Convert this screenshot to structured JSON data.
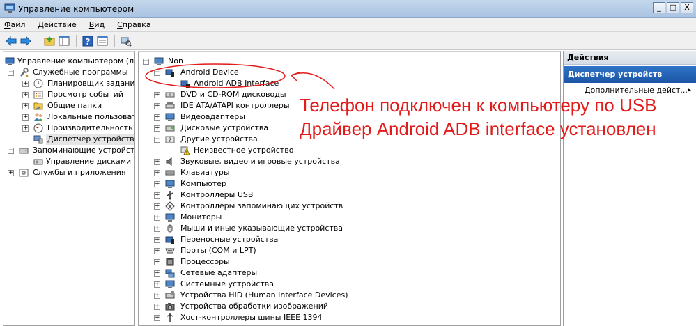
{
  "window": {
    "title": "Управление компьютером",
    "buttons": {
      "minimize": "_",
      "maximize": "□",
      "close": "X"
    }
  },
  "menu": {
    "items": [
      {
        "accel": "Ф",
        "rest": "айл"
      },
      {
        "accel": "Д",
        "rest": "ействие"
      },
      {
        "accel": "В",
        "rest": "ид"
      },
      {
        "accel": "С",
        "rest": "правка"
      }
    ]
  },
  "toolbar": {
    "icons": [
      "back-arrow-icon",
      "forward-arrow-icon",
      "up-folder-icon",
      "show-hide-tree-icon",
      "help-icon",
      "properties-icon",
      "scan-hardware-icon"
    ]
  },
  "left_tree": {
    "root": "Управление компьютером (лока",
    "system_tools": "Служебные программы",
    "task_scheduler": "Планировщик заданий",
    "event_viewer": "Просмотр событий",
    "shared_folders": "Общие папки",
    "local_users": "Локальные пользовател",
    "performance": "Производительность",
    "device_manager": "Диспетчер устройств",
    "storage": "Запоминающие устройства",
    "disk_management": "Управление дисками",
    "services": "Службы и приложения"
  },
  "device_tree": {
    "computer_name": "iNon",
    "android_device": "Android Device",
    "android_adb": "Android ADB Interface",
    "dvd": "DVD и CD-ROM дисководы",
    "ide": "IDE ATA/ATAPI контроллеры",
    "video": "Видеоадаптеры",
    "disk": "Дисковые устройства",
    "other": "Другие устройства",
    "unknown": "Неизвестное устройство",
    "sound": "Звуковые, видео и игровые устройства",
    "keyboards": "Клавиатуры",
    "computer": "Компьютер",
    "usb": "Контроллеры USB",
    "storage_ctrl": "Контроллеры запоминающих устройств",
    "monitors": "Мониторы",
    "mice": "Мыши и иные указывающие устройства",
    "portable": "Переносные устройства",
    "ports": "Порты (COM и LPT)",
    "processors": "Процессоры",
    "network": "Сетевые адаптеры",
    "system": "Системные устройства",
    "hid": "Устройства HID (Human Interface Devices)",
    "imaging": "Устройства обработки изображений",
    "ieee1394": "Хост-контроллеры шины IEEE 1394"
  },
  "actions_pane": {
    "header": "Действия",
    "section": "Диспетчер устройств",
    "more_actions": "Дополнительные дейст...",
    "arrow": "▸"
  },
  "annotation": {
    "line1": "Телефон подключен к компьютеру по USB",
    "line2": "Драйвер Android ADB interface установлен",
    "color": "#e21b1b"
  },
  "colors": {
    "selection_bg": "#e5e5e5",
    "actions_section_bg": "#1f5fb0",
    "titlebar_bg": "#b9cfe8"
  }
}
